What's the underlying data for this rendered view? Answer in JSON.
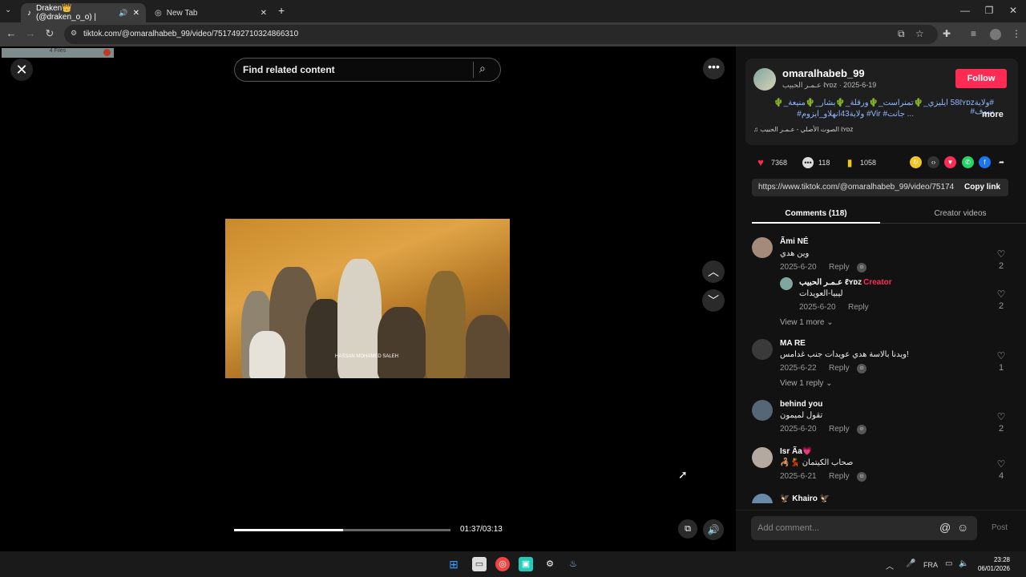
{
  "browser": {
    "tabs": [
      {
        "label": "Draken👑 (@draken_o_o) |",
        "active": true
      },
      {
        "label": "New Tab",
        "active": false
      }
    ],
    "new_tab_symbol": "+",
    "url": "tiktok.com/@omaralhabeb_99/video/7517492710324866310"
  },
  "overlay": {
    "files_chip": "4 Files"
  },
  "player": {
    "search_placeholder": "Find related content",
    "watermark": "HASSAN MOHAMED SALEH",
    "time": "01:37/03:13",
    "progress": 0.503
  },
  "post": {
    "username": "omaralhabeb_99",
    "subline": "عـمـر الحبيب ℓʏᴅᴢ · 2025-6-19",
    "follow_label": "Follow",
    "caption_line1": "#ولاية58ℓʏᴅᴢ ايليزي_🌵تمنراست_🌵ورقلة_🌵بشار_🌵منيعة_🌵سوف#",
    "caption_line2": "... جانت# Vir# ولاية43انهلاو_ايزوم#",
    "more_label": "more",
    "music": "الصوت الأصلي - عـمـر الحبيب ℓʏᴅᴢ",
    "likes": "7368",
    "comments": "118",
    "saves": "1058",
    "link": "https://www.tiktok.com/@omaralhabeb_99/video/75174...",
    "copy_label": "Copy link"
  },
  "tabs": {
    "comments": "Comments (118)",
    "creator": "Creator videos"
  },
  "comments": [
    {
      "name": "Ãmi NÉ",
      "text": "وين هدي",
      "date": "2025-6-20",
      "reply": "Reply",
      "likes": "2"
    },
    {
      "name": "عـمـر الحبيب ℓʏᴅᴢ",
      "creator": "· Creator",
      "text": "ليبيا-العويدات",
      "date": "2025-6-20",
      "reply": "Reply",
      "likes": "2"
    },
    {
      "view": "View 1 more"
    },
    {
      "name": "MA RE",
      "text": "ويدنا بالاسة هدي عويدات جنب غدامس!",
      "date": "2025-6-22",
      "reply": "Reply",
      "likes": "1"
    },
    {
      "view": "View 1 reply"
    },
    {
      "name": "behind you",
      "text": "تقول لميمون",
      "date": "2025-6-20",
      "reply": "Reply",
      "likes": "2"
    },
    {
      "name": "Isr Ãa💗",
      "text": "🦂💃 صحاب الكيتمان",
      "date": "2025-6-21",
      "reply": "Reply",
      "likes": "4"
    },
    {
      "name": "🦅 Khairo 🦅"
    }
  ],
  "comment_bar": {
    "placeholder": "Add comment...",
    "post_label": "Post"
  },
  "taskbar": {
    "lang": "FRA",
    "time": "23:28",
    "date": "06/01/2026"
  },
  "colors": {
    "accent": "#fe2c55",
    "hashtag": "#8fb7ff"
  }
}
